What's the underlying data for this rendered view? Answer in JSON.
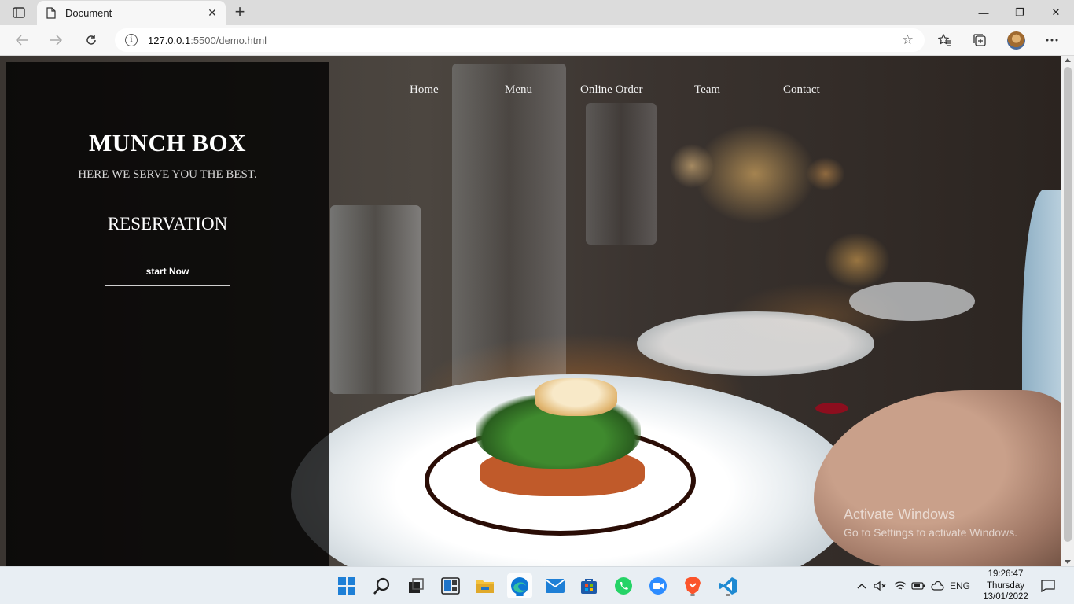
{
  "browser": {
    "tab_title": "Document",
    "url_host": "127.0.0.1",
    "url_rest": ":5500/demo.html",
    "new_tab_symbol": "+",
    "controls": {
      "minimize": "—",
      "maximize": "❐",
      "close": "✕"
    },
    "icons": [
      "tab-actions-icon",
      "document-icon",
      "close-icon",
      "back-icon",
      "forward-icon",
      "refresh-icon",
      "info-icon",
      "add-favorite-icon",
      "favorites-icon",
      "collections-icon",
      "profile-avatar",
      "more-icon"
    ]
  },
  "page": {
    "nav": [
      "Home",
      "Menu",
      "Online Order",
      "Team",
      "Contact"
    ],
    "brand": "MUNCH BOX",
    "tagline": "HERE WE SERVE YOU THE BEST.",
    "section_title": "RESERVATION",
    "cta_label": "start Now"
  },
  "watermark": {
    "line1": "Activate Windows",
    "line2": "Go to Settings to activate Windows."
  },
  "taskbar": {
    "apps": [
      "windows-start-icon",
      "search-icon",
      "task-view-icon",
      "widgets-icon",
      "file-explorer-icon",
      "edge-icon",
      "mail-icon",
      "store-icon",
      "whatsapp-icon",
      "zoom-icon",
      "brave-icon",
      "vscode-icon"
    ],
    "tray_lang": "ENG",
    "time": "19:26:47",
    "day": "Thursday",
    "date": "13/01/2022"
  },
  "colors": {
    "edge_blue": "#0c77d4",
    "vscode_blue": "#1f8ad2",
    "whatsapp_green": "#25d366",
    "zoom_blue": "#2d8cff",
    "brave_orange": "#fb542b",
    "folder_yellow": "#f4c23d"
  }
}
